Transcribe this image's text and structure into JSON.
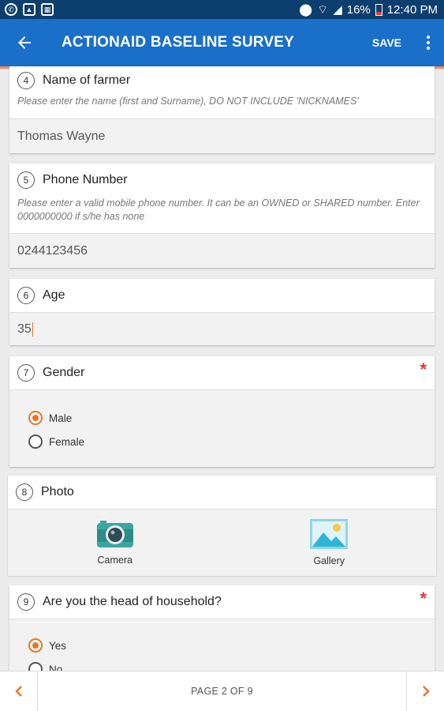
{
  "status_bar": {
    "battery": "16%",
    "time": "12:40 PM",
    "icons": [
      "whatsapp-icon",
      "image-icon",
      "gallery-icon",
      "location-icon",
      "wifi-icon",
      "signal-icon",
      "battery-icon"
    ]
  },
  "app_bar": {
    "title": "ACTIONAID BASELINE SURVEY",
    "save_label": "SAVE",
    "icons": [
      "back-arrow-icon",
      "more-vert-icon"
    ]
  },
  "questions": {
    "q4": {
      "number": "4",
      "title": "Name of farmer",
      "hint": "Please enter the name (first and Surname), DO NOT INCLUDE 'NICKNAMES'",
      "value": "Thomas Wayne"
    },
    "q5": {
      "number": "5",
      "title": "Phone Number",
      "hint": "Please enter a valid mobile phone number. It can be an OWNED or SHARED number. Enter 0000000000 if s/he has none",
      "value": "0244123456"
    },
    "q6": {
      "number": "6",
      "title": "Age",
      "value": "35"
    },
    "q7": {
      "number": "7",
      "title": "Gender",
      "required_mark": "*",
      "options": [
        "Male",
        "Female"
      ],
      "selected": "Male"
    },
    "q8": {
      "number": "8",
      "title": "Photo",
      "camera_label": "Camera",
      "gallery_label": "Gallery"
    },
    "q9": {
      "number": "9",
      "title": "Are you the head of household?",
      "required_mark": "*",
      "options": [
        "Yes",
        "No"
      ],
      "selected": "Yes"
    }
  },
  "pagination": {
    "label": "PAGE 2 OF 9"
  },
  "colors": {
    "app_bar": "#1a6fc9",
    "status_bar": "#0d3f6e",
    "accent": "#e8742a",
    "required": "#e53935",
    "camera_icon": "#3aa6a0",
    "gallery_icon": "#2fb6d6"
  }
}
